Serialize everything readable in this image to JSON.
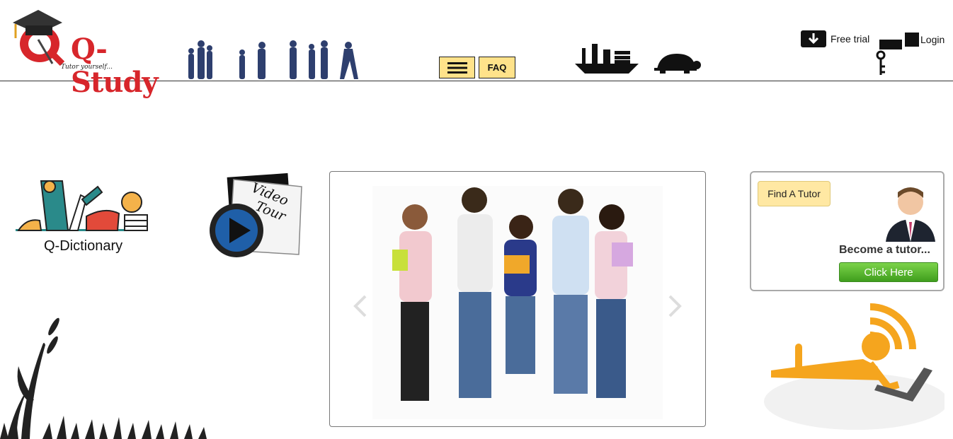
{
  "header": {
    "logo_text": "Q-Study",
    "logo_tagline": "Tutor yourself...",
    "faq_label": "FAQ",
    "free_trial_label": "Free trial",
    "login_label": "Login"
  },
  "widgets": {
    "qdictionary_label": "Q-Dictionary",
    "video_tour_line1": "Video",
    "video_tour_line2": "Tour"
  },
  "tutor_card": {
    "find_tutor_label": "Find A Tutor",
    "become_text": "Become a tutor...",
    "click_here_label": "Click Here"
  },
  "colors": {
    "brand_red": "#d7262b",
    "button_yellow": "#ffe28a",
    "silhouette_blue": "#2e3f6e",
    "click_green": "#4fae2a",
    "wifi_orange": "#f5a51e"
  }
}
